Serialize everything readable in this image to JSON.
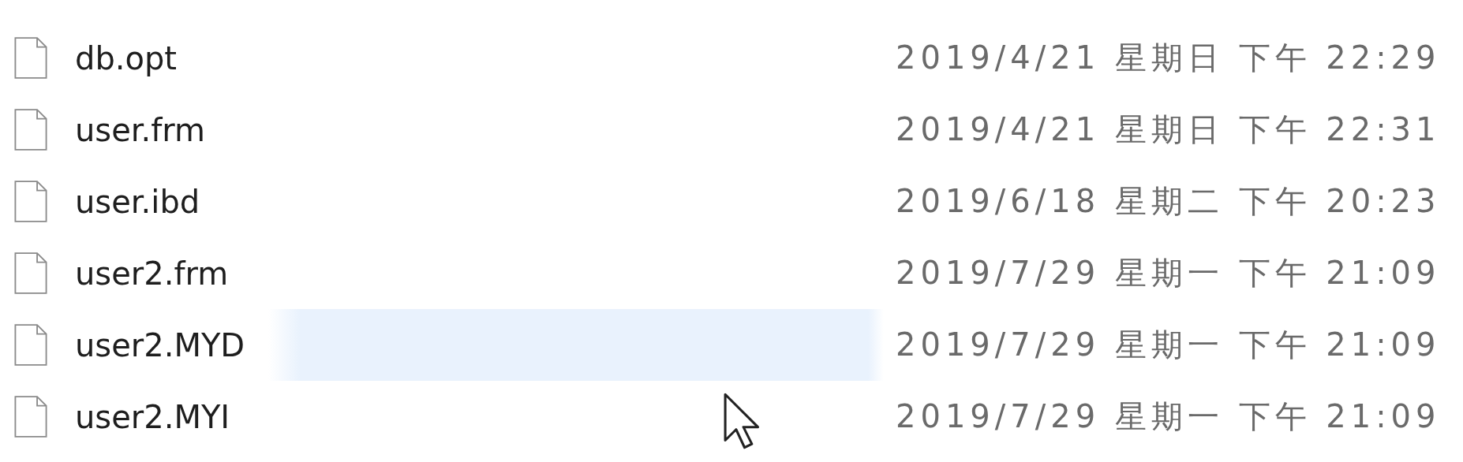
{
  "files": [
    {
      "name": "db.opt",
      "modified": "2019/4/21 星期日 下午 22:29",
      "hovered": false
    },
    {
      "name": "user.frm",
      "modified": "2019/4/21 星期日 下午 22:31",
      "hovered": false
    },
    {
      "name": "user.ibd",
      "modified": "2019/6/18 星期二 下午 20:23",
      "hovered": false
    },
    {
      "name": "user2.frm",
      "modified": "2019/7/29 星期一 下午 21:09",
      "hovered": false
    },
    {
      "name": "user2.MYD",
      "modified": "2019/7/29 星期一 下午 21:09",
      "hovered": true
    },
    {
      "name": "user2.MYI",
      "modified": "2019/7/29 星期一 下午 21:09",
      "hovered": false
    }
  ]
}
